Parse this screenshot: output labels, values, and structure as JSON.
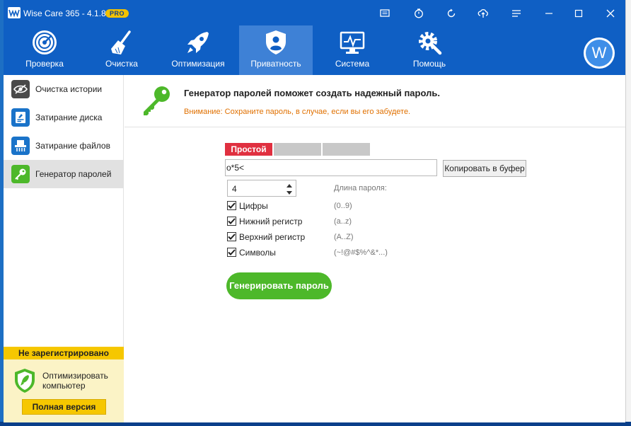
{
  "window": {
    "title": "Wise Care 365 - 4.1.8",
    "badge": "PRO"
  },
  "nav": {
    "items": [
      {
        "label": "Проверка",
        "icon": "radar-icon"
      },
      {
        "label": "Очистка",
        "icon": "broom-icon"
      },
      {
        "label": "Оптимизация",
        "icon": "rocket-icon"
      },
      {
        "label": "Приватность",
        "icon": "shield-icon"
      },
      {
        "label": "Система",
        "icon": "monitor-icon"
      },
      {
        "label": "Помощь",
        "icon": "gear-icon"
      }
    ],
    "active": "Приватность",
    "avatar_letter": "W"
  },
  "sidebar": {
    "items": [
      {
        "label": "Очистка истории",
        "icon": "eye-icon"
      },
      {
        "label": "Затирание диска",
        "icon": "disk-icon"
      },
      {
        "label": "Затирание файлов",
        "icon": "shredder-icon"
      },
      {
        "label": "Генератор паролей",
        "icon": "key-icon"
      }
    ],
    "active": "Генератор паролей",
    "promo": {
      "header": "Не зарегистрировано",
      "text": "Оптимизировать компьютер",
      "button": "Полная версия"
    }
  },
  "content": {
    "title": "Генератор паролей поможет создать надежный пароль.",
    "warning": "Внимание: Сохраните пароль, в случае, если вы его забудете.",
    "strength_label": "Простой",
    "strength_level": "1/3",
    "password": "o*5<",
    "copy_button": "Копировать в буфер",
    "length_value": "4",
    "length_label": "Длина пароля:",
    "options": [
      {
        "label": "Цифры",
        "hint": "(0..9)",
        "checked": true
      },
      {
        "label": "Нижний регистр",
        "hint": "(a..z)",
        "checked": true
      },
      {
        "label": "Верхний регистр",
        "hint": "(A..Z)",
        "checked": true
      },
      {
        "label": "Символы",
        "hint": "(~!@#$%^&*...)",
        "checked": true
      }
    ],
    "generate_button": "Генерировать пароль"
  },
  "colors": {
    "titlebar": "#0f5fc4",
    "nav_active": "#3e81d6",
    "strength_weak": "#e03040",
    "generate": "#4db82a",
    "warning": "#e07000",
    "promo": "#f6c700"
  }
}
